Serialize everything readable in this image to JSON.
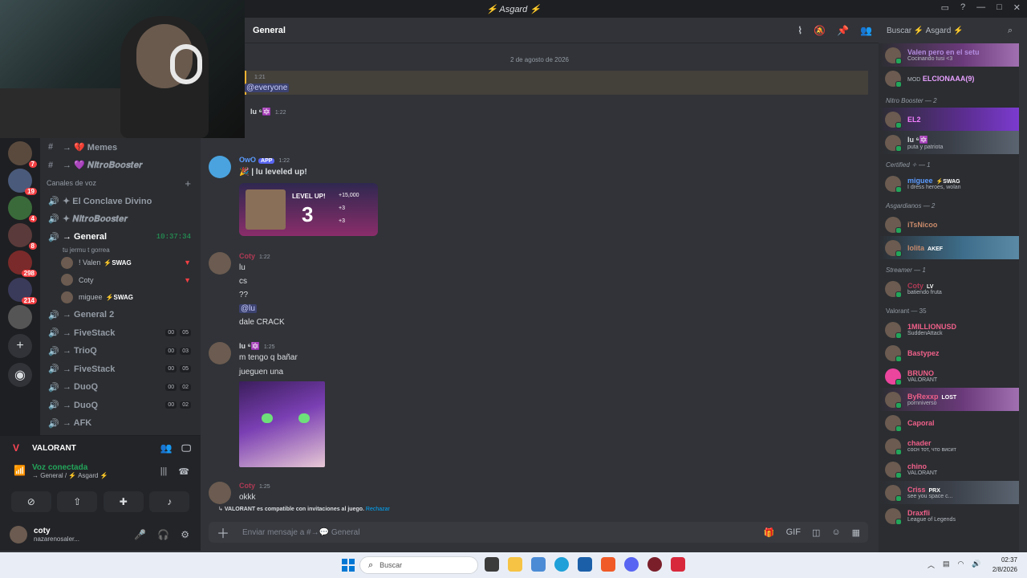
{
  "window": {
    "title": "⚡ Asgard ⚡"
  },
  "server_rail": {
    "badges": [
      "7",
      "19",
      "4",
      "8",
      "298",
      "214"
    ],
    "add_icon": "plus-icon",
    "explore_icon": "compass-icon"
  },
  "channels": {
    "text": [
      {
        "name": "→ 💔 Memes"
      },
      {
        "name": "→ 💜 𝑵𝒊𝒕𝒓𝒐𝑩𝒐𝒐𝒔𝒕𝒆𝒓"
      }
    ],
    "voice_category": "Canales de voz",
    "voice": [
      {
        "name": "✦ El Conclave Divino"
      },
      {
        "name": "✦ 𝑵𝒊𝒕𝒓𝒐𝑩𝒐𝒐𝒔𝒕𝒆𝒓"
      },
      {
        "name": "→ General",
        "time": "10:37:34",
        "sub": "tu jermu t gorrea"
      }
    ],
    "voice_users": [
      {
        "name": "! Valen",
        "tag": "⚡SWAG"
      },
      {
        "name": "Coty",
        "tag": ""
      },
      {
        "name": "miguee",
        "tag": "⚡SWAG"
      }
    ],
    "voice_more": [
      {
        "name": "→ General 2",
        "d1": "",
        "d2": ""
      },
      {
        "name": "→ FiveStack",
        "d1": "00",
        "d2": "05"
      },
      {
        "name": "→ TrioQ",
        "d1": "00",
        "d2": "03"
      },
      {
        "name": "→ FiveStack",
        "d1": "00",
        "d2": "05"
      },
      {
        "name": "→ DuoQ",
        "d1": "00",
        "d2": "02"
      },
      {
        "name": "→ DuoQ",
        "d1": "00",
        "d2": "02"
      },
      {
        "name": "→ AFK",
        "d1": "",
        "d2": ""
      }
    ]
  },
  "activity": {
    "game": "VALORANT",
    "voice_status": "Voz conectada",
    "voice_location": "→ General / ⚡ Asgard ⚡"
  },
  "user": {
    "name": "coty",
    "status": "nazarenosaler..."
  },
  "chat": {
    "channel": "General",
    "date_divider": "2 de agosto de 2026",
    "messages": [
      {
        "author": "",
        "time": "1:21",
        "lines": [
          "@everyone"
        ]
      },
      {
        "author": "lu ⁶🔯",
        "time": "1:22",
        "lines": [
          ""
        ]
      },
      {
        "author": "OwO",
        "app": "APP",
        "time": "1:22",
        "lines": [
          "🎉 | lu leveled up!"
        ]
      },
      {
        "author": "Coty",
        "time": "1:22",
        "lines": [
          "lu",
          "cs",
          "??",
          "@lu",
          "dale CRACK"
        ]
      },
      {
        "author": "lu ⁶🔯",
        "time": "1:25",
        "lines": [
          "m tengo q bañar",
          "jueguen una"
        ]
      },
      {
        "author": "Coty",
        "time": "1:25",
        "lines": [
          "okkk"
        ]
      }
    ],
    "level_card": {
      "label": "LEVEL UP!",
      "level": "3",
      "xp": "+15,000",
      "r1": "+3",
      "r2": "+3"
    },
    "invite_text": "VALORANT es compatible con invitaciones al juego.",
    "invite_action": "Rechazar",
    "composer_placeholder": "Enviar mensaje a #→💬 General"
  },
  "search": {
    "placeholder": "Buscar ⚡ Asgard ⚡"
  },
  "members": {
    "top": [
      {
        "name": "Valen pero en el setu",
        "act": "Cocinando tusi <3",
        "color": "#b48ce0"
      },
      {
        "name": "ELCIONAAA(9)",
        "act": "",
        "color": "#e8a0ff",
        "pre": "MOD"
      }
    ],
    "groups": [
      {
        "title": "Nitro Booster — 2",
        "items": [
          {
            "name": "EL2",
            "act": "",
            "color": "#f47fff"
          },
          {
            "name": "lu ⁶🔯",
            "act": "puta y patriota",
            "color": "#dbdee1"
          }
        ]
      },
      {
        "title": "Certified ✧ — 1",
        "items": [
          {
            "name": "miguee",
            "badge": "⚡SWAG",
            "act": "I dress heroes, wolan",
            "color": "#5b9bff"
          }
        ]
      },
      {
        "title": "Asgardianos — 2",
        "items": [
          {
            "name": "iTsNicoo",
            "act": "",
            "color": "#c98a6a"
          },
          {
            "name": "lolita",
            "badge": "AKEF",
            "act": "",
            "color": "#c98a6a"
          }
        ]
      },
      {
        "title": "Streamer — 1",
        "items": [
          {
            "name": "Coty",
            "badge": "LV",
            "act": "batiendo fruta",
            "color": "#b03a55"
          }
        ]
      },
      {
        "title": "Valorant — 35",
        "items": [
          {
            "name": "1MILLIONUSD",
            "act": "SuddenAttack",
            "color": "#f0608a"
          },
          {
            "name": "Bastypez",
            "act": "",
            "color": "#f0608a"
          },
          {
            "name": "BRUNO",
            "act": "VALORANT",
            "color": "#f0608a"
          },
          {
            "name": "ByRexxp",
            "badge": "LOST",
            "act": "pornniverso",
            "color": "#f0608a"
          },
          {
            "name": "Caporal",
            "act": "",
            "color": "#f0608a"
          },
          {
            "name": "chader",
            "act": "сосн тот, что висит",
            "color": "#f0608a"
          },
          {
            "name": "chino",
            "act": "VALORANT",
            "color": "#f0608a"
          },
          {
            "name": "Criss",
            "badge": "PRX",
            "act": "see you space c...",
            "color": "#f0608a"
          },
          {
            "name": "Draxfli",
            "act": "League of Legends",
            "color": "#f0608a"
          }
        ]
      }
    ]
  },
  "taskbar": {
    "search": "Buscar",
    "time": "02:37",
    "date": "2/8/2026"
  }
}
